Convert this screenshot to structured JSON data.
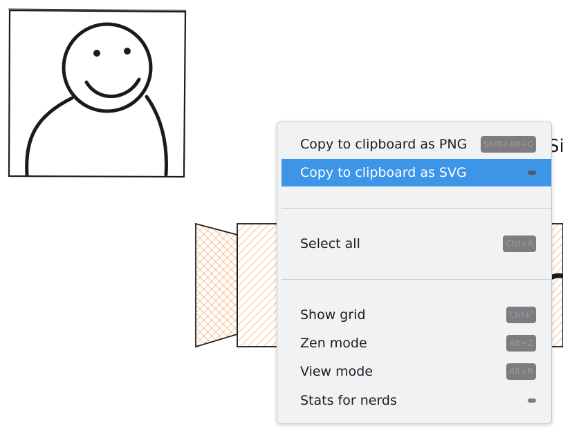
{
  "menu": {
    "items": [
      {
        "label": "Copy to clipboard as PNG",
        "shortcut": "Shift+Alt+C",
        "active": false
      },
      {
        "label": "Copy to clipboard as SVG",
        "shortcut": "",
        "active": true
      },
      {
        "label": "Select all",
        "shortcut": "Ctrl+A",
        "active": false
      },
      {
        "label": "Show grid",
        "shortcut": "Ctrl+'",
        "active": false
      },
      {
        "label": "Zen mode",
        "shortcut": "Alt+Z",
        "active": false
      },
      {
        "label": "View mode",
        "shortcut": "Alt+R",
        "active": false
      },
      {
        "label": "Stats for nerds",
        "shortcut": "",
        "active": false
      }
    ]
  },
  "colors": {
    "accent": "#3d95e8",
    "menu_bg": "#f1f2f4",
    "hatch_orange": "#f4a15a"
  },
  "canvas": {
    "background_text": "Si"
  }
}
